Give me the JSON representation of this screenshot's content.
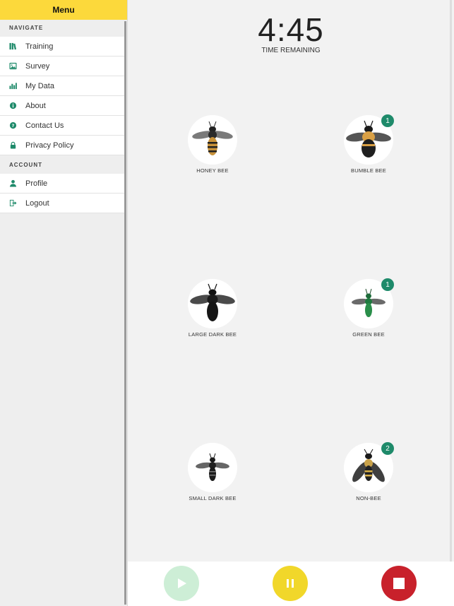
{
  "sidebar": {
    "title": "Menu",
    "navigate_label": "NAVIGATE",
    "nav_items": [
      {
        "label": "Training",
        "icon": "library-icon"
      },
      {
        "label": "Survey",
        "icon": "image-icon"
      },
      {
        "label": "My Data",
        "icon": "bar-chart-icon"
      },
      {
        "label": "About",
        "icon": "info-icon"
      },
      {
        "label": "Contact Us",
        "icon": "help-icon"
      },
      {
        "label": "Privacy Policy",
        "icon": "lock-icon"
      }
    ],
    "account_label": "ACCOUNT",
    "account_items": [
      {
        "label": "Profile",
        "icon": "person-icon"
      },
      {
        "label": "Logout",
        "icon": "logout-icon"
      }
    ]
  },
  "timer": {
    "value": "4:45",
    "label": "TIME REMAINING"
  },
  "bees": [
    {
      "name": "HONEY BEE",
      "count": null
    },
    {
      "name": "BUMBLE BEE",
      "count": "1"
    },
    {
      "name": "LARGE DARK BEE",
      "count": null
    },
    {
      "name": "GREEN BEE",
      "count": "1"
    },
    {
      "name": "SMALL DARK BEE",
      "count": null
    },
    {
      "name": "NON-BEE",
      "count": "2"
    }
  ],
  "controls": {
    "play": "play-icon",
    "pause": "pause-icon",
    "stop": "stop-icon"
  },
  "colors": {
    "accent_yellow": "#fcd93b",
    "icon_green": "#1e8a6a",
    "play_green": "#cdeed6",
    "pause_yellow": "#f1d72a",
    "stop_red": "#c8212b"
  }
}
